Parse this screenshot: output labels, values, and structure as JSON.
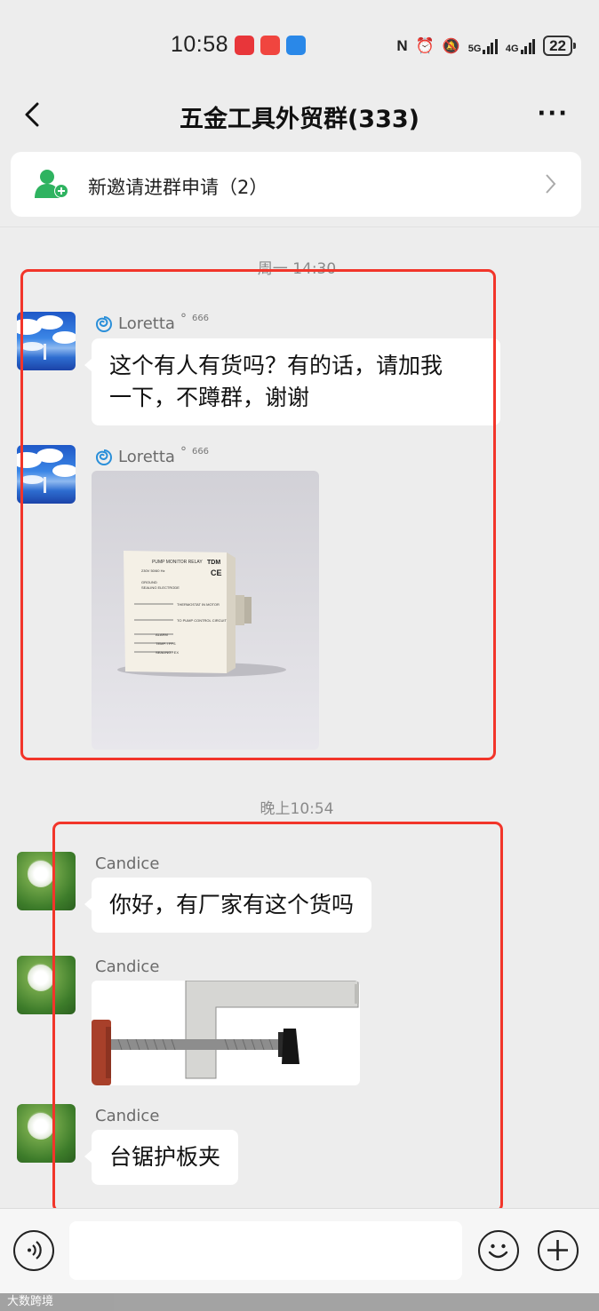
{
  "status_bar": {
    "time": "10:58",
    "network_5g": "5G",
    "network_4g": "4G",
    "battery": "22"
  },
  "header": {
    "title": "五金工具外贸群(333)",
    "more": "···"
  },
  "invite_banner": {
    "label": "新邀请进群申请（2）"
  },
  "messages": [
    {
      "type": "timestamp",
      "text": "周一 14:30"
    },
    {
      "sender": "Loretta",
      "badge": "666",
      "text": "这个有人有货吗？有的话，请加我一下，不蹲群，谢谢",
      "line1": "这个有人有货吗？有的话，请加我",
      "line2": "一下，不蹲群，谢谢"
    },
    {
      "sender": "Loretta",
      "badge": "666",
      "image_text": {
        "title": "PUMP MONITOR RELAY",
        "brand": "TDM",
        "l1": "230V 50/60 Hz",
        "l2": "GROUND",
        "l3": "SEALING ELECTRODE",
        "l4": "THERMOSTAT IN MOTOR",
        "l5": "TO PUMP CONTROL CIRCUIT",
        "l6": "ALARM",
        "l7": "TEMP. / FFS",
        "l8": "SEALING / EX",
        "ce": "CE"
      }
    },
    {
      "type": "timestamp",
      "text": "晚上10:54"
    },
    {
      "sender": "Candice",
      "text": "你好，有厂家有这个货吗"
    },
    {
      "sender": "Candice"
    },
    {
      "sender": "Candice",
      "text": "台锯护板夹"
    }
  ],
  "watermark": "大数跨境",
  "colors": {
    "highlight_box": "#f2352a",
    "bubble": "#ffffff",
    "background": "#ededed",
    "invite_icon": "#2fb360"
  }
}
